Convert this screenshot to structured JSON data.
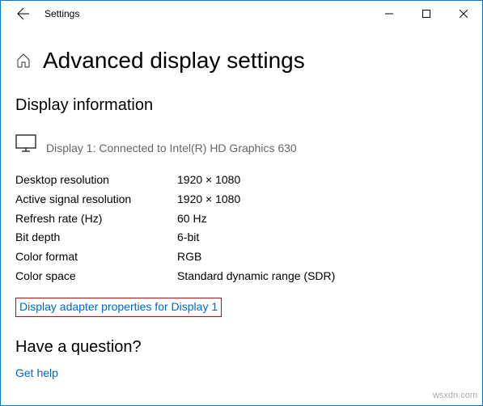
{
  "titlebar": {
    "title": "Settings"
  },
  "header": {
    "page_title": "Advanced display settings"
  },
  "display_info": {
    "heading": "Display information",
    "connected": "Display 1: Connected to Intel(R) HD Graphics 630",
    "rows": [
      {
        "label": "Desktop resolution",
        "value": "1920 × 1080"
      },
      {
        "label": "Active signal resolution",
        "value": "1920 × 1080"
      },
      {
        "label": "Refresh rate (Hz)",
        "value": "60 Hz"
      },
      {
        "label": "Bit depth",
        "value": "6-bit"
      },
      {
        "label": "Color format",
        "value": "RGB"
      },
      {
        "label": "Color space",
        "value": "Standard dynamic range (SDR)"
      }
    ],
    "adapter_link": "Display adapter properties for Display 1"
  },
  "question": {
    "heading": "Have a question?",
    "help_link": "Get help"
  },
  "watermark": "wsxdn.com"
}
